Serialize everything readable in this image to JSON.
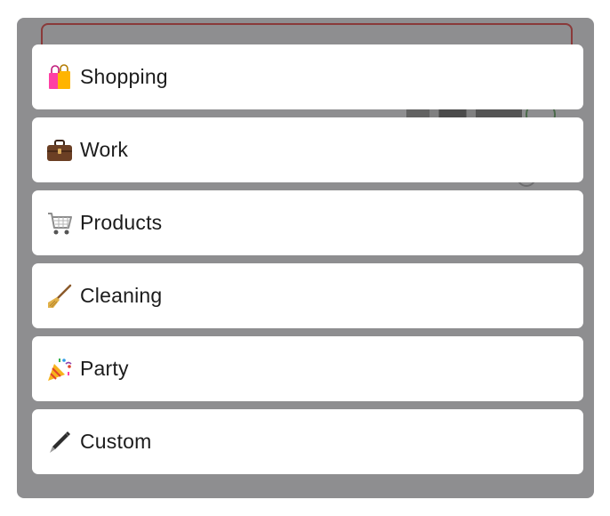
{
  "menu": {
    "items": [
      {
        "label": "Shopping",
        "icon": "shopping-bags-icon"
      },
      {
        "label": "Work",
        "icon": "briefcase-icon"
      },
      {
        "label": "Products",
        "icon": "shopping-cart-icon"
      },
      {
        "label": "Cleaning",
        "icon": "broom-icon"
      },
      {
        "label": "Party",
        "icon": "party-popper-icon"
      },
      {
        "label": "Custom",
        "icon": "pen-icon"
      }
    ]
  },
  "colors": {
    "backdrop": "#8e8e90",
    "item_background": "#ffffff",
    "text": "#1c1c1c"
  }
}
